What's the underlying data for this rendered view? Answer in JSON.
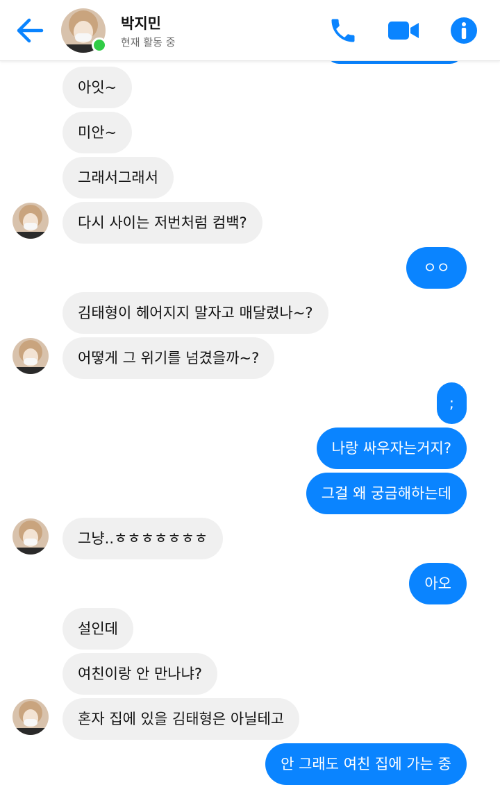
{
  "header": {
    "name": "박지민",
    "status": "현재 활동 중"
  },
  "icons": {
    "back": "arrow-left-icon",
    "call": "phone-icon",
    "video": "video-camera-icon",
    "info": "info-icon"
  },
  "colors": {
    "accent": "#0a84ff",
    "incoming_bubble": "#f0f0f0",
    "online": "#31cc46"
  },
  "messages": [
    {
      "from": "them",
      "text": "아잇~"
    },
    {
      "from": "them",
      "text": "미안~"
    },
    {
      "from": "them",
      "text": "그래서그래서"
    },
    {
      "from": "them",
      "text": "다시 사이는 저번처럼 컴백?"
    },
    {
      "from": "me",
      "text": "ㅇㅇ"
    },
    {
      "from": "them",
      "text": "김태형이 헤어지지 말자고 매달렸나~?"
    },
    {
      "from": "them",
      "text": "어떻게 그 위기를 넘겼을까~?"
    },
    {
      "from": "me",
      "text": ";"
    },
    {
      "from": "me",
      "text": "나랑 싸우자는거지?"
    },
    {
      "from": "me",
      "text": "그걸 왜 궁금해하는데"
    },
    {
      "from": "them",
      "text": "그냥..ㅎㅎㅎㅎㅎㅎㅎ"
    },
    {
      "from": "me",
      "text": "아오"
    },
    {
      "from": "them",
      "text": "설인데"
    },
    {
      "from": "them",
      "text": "여친이랑 안 만나냐?"
    },
    {
      "from": "them",
      "text": "혼자 집에 있을 김태형은 아닐테고"
    },
    {
      "from": "me",
      "text": "안 그래도 여친 집에 가는 중"
    }
  ]
}
